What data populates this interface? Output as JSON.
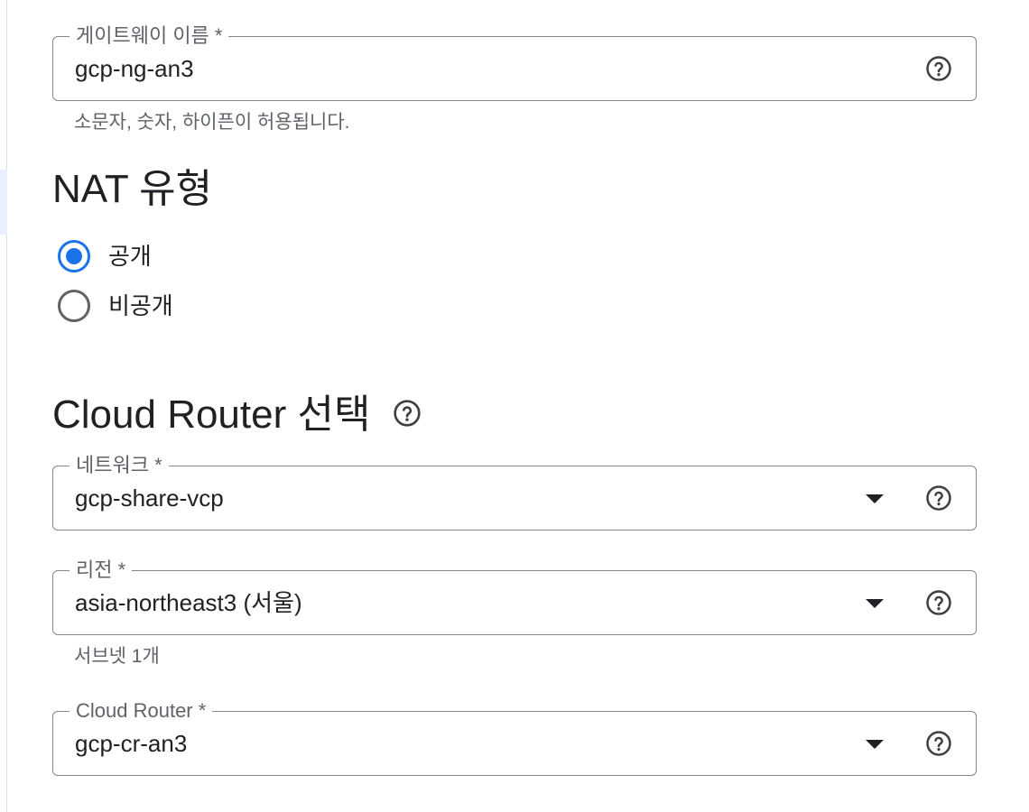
{
  "gateway_name": {
    "label": "게이트웨이 이름 *",
    "value": "gcp-ng-an3",
    "hint": "소문자, 숫자, 하이픈이 허용됩니다.",
    "help_icon": "help-circle-icon"
  },
  "nat_type": {
    "title": "NAT 유형",
    "options": [
      {
        "label": "공개",
        "selected": true
      },
      {
        "label": "비공개",
        "selected": false
      }
    ]
  },
  "cloud_router_section": {
    "title": "Cloud Router 선택",
    "help_icon": "help-circle-icon"
  },
  "network": {
    "label": "네트워크 *",
    "value": "gcp-share-vcp",
    "dropdown_icon": "caret-down-icon",
    "help_icon": "help-circle-icon"
  },
  "region": {
    "label": "리전 *",
    "value": "asia-northeast3 (서울)",
    "hint": "서브넷 1개",
    "dropdown_icon": "caret-down-icon",
    "help_icon": "help-circle-icon"
  },
  "cloud_router": {
    "label": "Cloud Router *",
    "value": "gcp-cr-an3",
    "dropdown_icon": "caret-down-icon",
    "help_icon": "help-circle-icon"
  },
  "colors": {
    "accent": "#1a73e8",
    "text": "#202124",
    "secondary_text": "#5f6368",
    "outline": "#80868b"
  }
}
